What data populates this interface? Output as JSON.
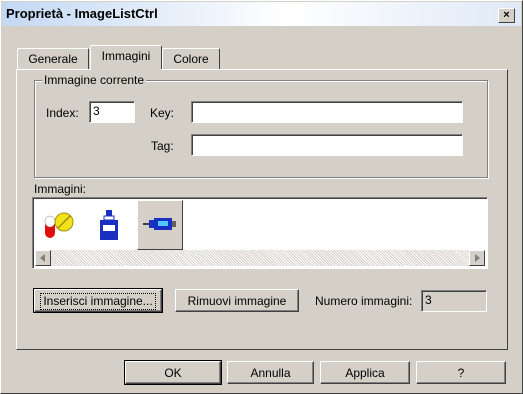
{
  "window": {
    "title": "Proprietà - ImageListCtrl",
    "close_glyph": "×"
  },
  "tabs": [
    {
      "label": "Generale"
    },
    {
      "label": "Immagini"
    },
    {
      "label": "Colore"
    }
  ],
  "current_image": {
    "group_label": "Immagine corrente",
    "index_label": "Index:",
    "index_value": "3",
    "key_label": "Key:",
    "key_value": "",
    "tag_label": "Tag:",
    "tag_value": ""
  },
  "images": {
    "label": "Immagini:",
    "items": [
      {
        "icon": "pill-capsule-icon"
      },
      {
        "icon": "bottle-icon"
      },
      {
        "icon": "syringe-icon",
        "selected": true
      }
    ]
  },
  "actions": {
    "insert_label": "Inserisci immagine...",
    "remove_label": "Rimuovi immagine",
    "count_label": "Numero immagini:",
    "count_value": "3"
  },
  "footer": {
    "ok_label": "OK",
    "cancel_label": "Annulla",
    "apply_label": "Applica",
    "help_label": "?"
  }
}
